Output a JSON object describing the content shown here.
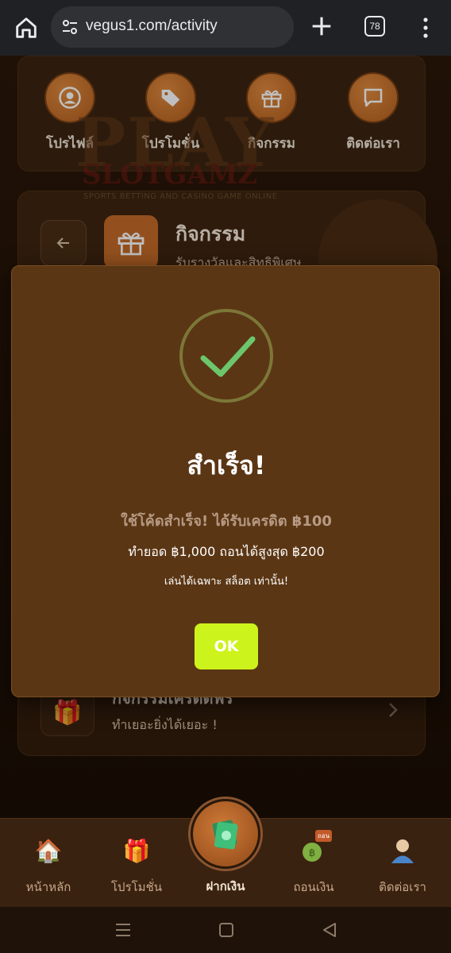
{
  "browser": {
    "url": "vegus1.com/activity",
    "tab_count": "78"
  },
  "top_nav": [
    {
      "label": "โปรไฟล์",
      "icon": "profile-icon"
    },
    {
      "label": "โปรโมชั่น",
      "icon": "tag-icon"
    },
    {
      "label": "กิจกรรม",
      "icon": "gift-icon"
    },
    {
      "label": "ติดต่อเรา",
      "icon": "chat-icon"
    }
  ],
  "watermark": {
    "big": "PLAY",
    "brand": "SLOTGAMZ",
    "tagline": "SPORTS BETTING AND CASINO GAME ONLINE"
  },
  "activity": {
    "title": "กิจกรรม",
    "subtitle": "รับรางวัลและสิทธิพิเศษ"
  },
  "promo_item": {
    "title": "กิจกรรมเครดิตฟรี",
    "subtitle": "ทำเยอะยิ่งได้เยอะ !"
  },
  "modal": {
    "title": "สำเร็จ!",
    "line1": "ใช้โค้ดสำเร็จ! ได้รับเครดิต ฿100",
    "line2": "ทำยอด ฿1,000 ถอนได้สูงสุด ฿200",
    "line3": "เล่นได้เฉพาะ สล็อต เท่านั้น!",
    "ok_label": "OK",
    "accent": "#cdf31c",
    "check_color": "#6cc76c"
  },
  "tabbar": {
    "items": [
      {
        "label": "หน้าหลัก",
        "icon": "home-icon"
      },
      {
        "label": "โปรโมชั่น",
        "icon": "gift-icon"
      },
      {
        "label": "ถอนเงิน",
        "icon": "withdraw-icon",
        "badge": "ถอน"
      },
      {
        "label": "ติดต่อเรา",
        "icon": "user-icon"
      }
    ],
    "center_label": "ฝากเงิน"
  }
}
